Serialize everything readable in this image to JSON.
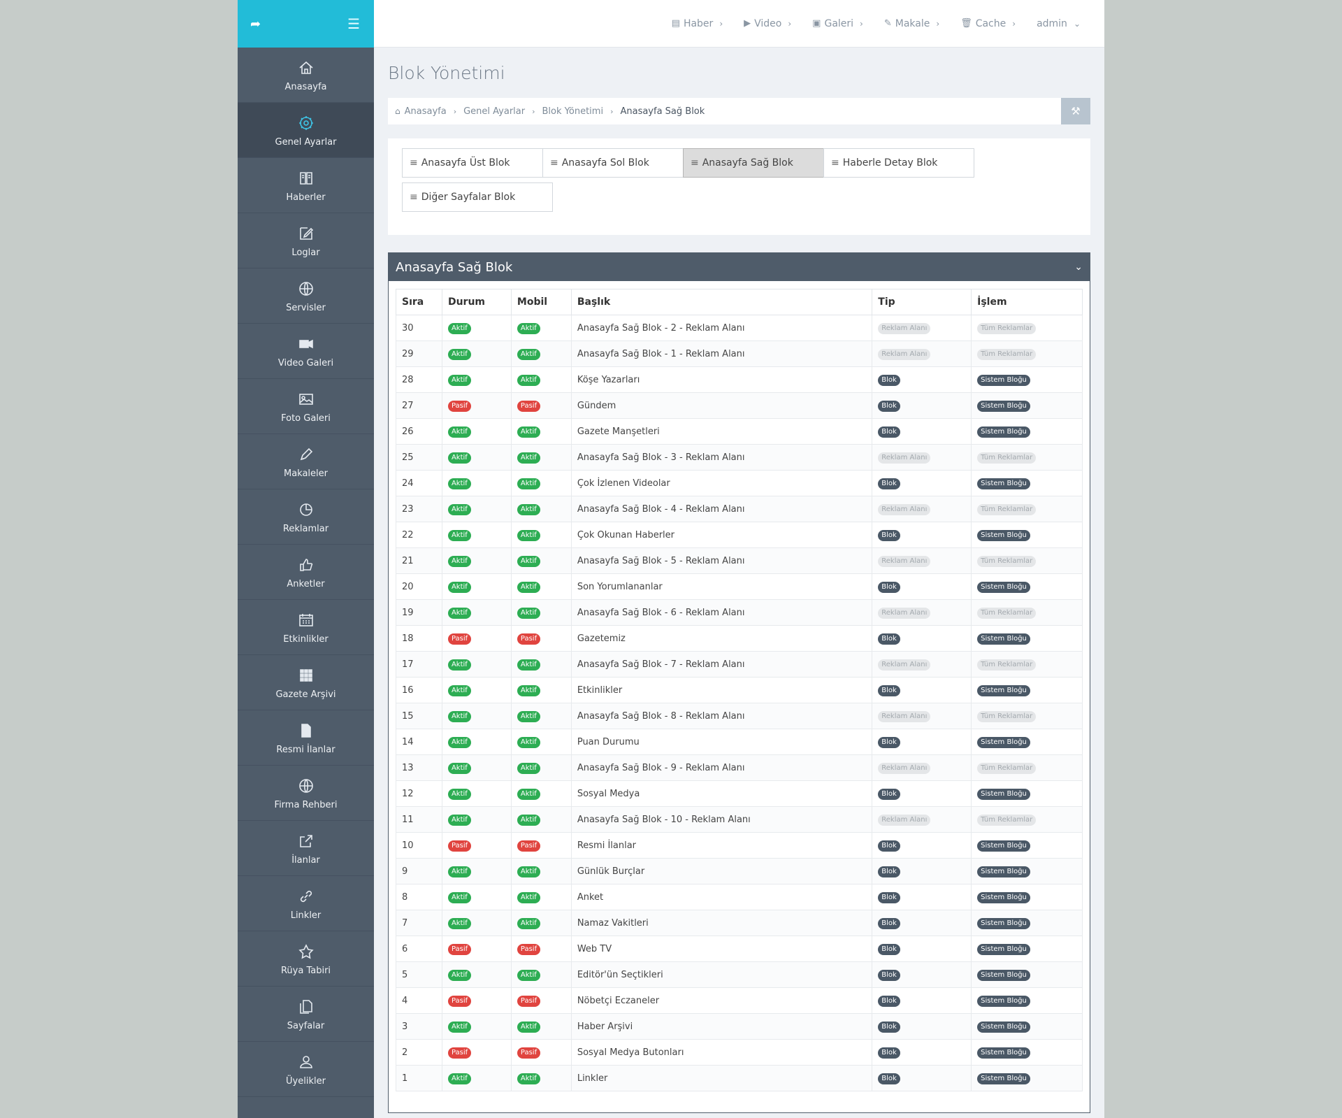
{
  "sidebar": {
    "items": [
      {
        "label": "Anasayfa",
        "icon": "home-icon",
        "active": false
      },
      {
        "label": "Genel Ayarlar",
        "icon": "gear-icon",
        "active": true
      },
      {
        "label": "Haberler",
        "icon": "book-icon",
        "active": false
      },
      {
        "label": "Loglar",
        "icon": "edit-icon",
        "active": false
      },
      {
        "label": "Servisler",
        "icon": "globe-icon",
        "active": false
      },
      {
        "label": "Video Galeri",
        "icon": "video-icon",
        "active": false
      },
      {
        "label": "Foto Galeri",
        "icon": "image-icon",
        "active": false
      },
      {
        "label": "Makaleler",
        "icon": "pencil-icon",
        "active": false
      },
      {
        "label": "Reklamlar",
        "icon": "pie-icon",
        "active": false
      },
      {
        "label": "Anketler",
        "icon": "thumbs-up-icon",
        "active": false
      },
      {
        "label": "Etkinlikler",
        "icon": "calendar-icon",
        "active": false
      },
      {
        "label": "Gazete Arşivi",
        "icon": "grid-icon",
        "active": false
      },
      {
        "label": "Resmi İlanlar",
        "icon": "file-icon",
        "active": false
      },
      {
        "label": "Firma Rehberi",
        "icon": "globe-icon",
        "active": false
      },
      {
        "label": "İlanlar",
        "icon": "share-icon",
        "active": false
      },
      {
        "label": "Linkler",
        "icon": "link-icon",
        "active": false
      },
      {
        "label": "Rüya Tabiri",
        "icon": "star-icon",
        "active": false
      },
      {
        "label": "Sayfalar",
        "icon": "copy-icon",
        "active": false
      },
      {
        "label": "Üyelikler",
        "icon": "user-icon",
        "active": false
      }
    ]
  },
  "topnav": {
    "items": [
      {
        "label": "Haber",
        "icon": "book-icon"
      },
      {
        "label": "Video",
        "icon": "video-icon"
      },
      {
        "label": "Galeri",
        "icon": "image-icon"
      },
      {
        "label": "Makale",
        "icon": "pencil-icon"
      },
      {
        "label": "Cache",
        "icon": "trash-icon"
      }
    ],
    "user": "admin"
  },
  "page": {
    "title": "Blok Yönetimi",
    "breadcrumb": [
      "Anasayfa",
      "Genel Ayarlar",
      "Blok Yönetimi",
      "Anasayfa Sağ Blok"
    ]
  },
  "blocks": [
    {
      "label": "Anasayfa Üst Blok",
      "active": false
    },
    {
      "label": "Anasayfa Sol Blok",
      "active": false
    },
    {
      "label": "Anasayfa Sağ Blok",
      "active": true
    },
    {
      "label": "Haberle Detay Blok",
      "active": false
    },
    {
      "label": "Diğer Sayfalar Blok",
      "active": false
    }
  ],
  "panel": {
    "title": "Anasayfa Sağ Blok",
    "headers": [
      "Sıra",
      "Durum",
      "Mobil",
      "Başlık",
      "Tip",
      "İşlem"
    ],
    "rows": [
      [
        "30",
        "Aktif",
        "Aktif",
        "Anasayfa Sağ Blok - 2 - Reklam Alanı",
        "Reklam Alanı",
        "Tüm Reklamlar"
      ],
      [
        "29",
        "Aktif",
        "Aktif",
        "Anasayfa Sağ Blok - 1 - Reklam Alanı",
        "Reklam Alanı",
        "Tüm Reklamlar"
      ],
      [
        "28",
        "Aktif",
        "Aktif",
        "Köşe Yazarları",
        "Blok",
        "Sistem Bloğu"
      ],
      [
        "27",
        "Pasif",
        "Pasif",
        "Gündem",
        "Blok",
        "Sistem Bloğu"
      ],
      [
        "26",
        "Aktif",
        "Aktif",
        "Gazete Manşetleri",
        "Blok",
        "Sistem Bloğu"
      ],
      [
        "25",
        "Aktif",
        "Aktif",
        "Anasayfa Sağ Blok - 3 - Reklam Alanı",
        "Reklam Alanı",
        "Tüm Reklamlar"
      ],
      [
        "24",
        "Aktif",
        "Aktif",
        "Çok İzlenen Videolar",
        "Blok",
        "Sistem Bloğu"
      ],
      [
        "23",
        "Aktif",
        "Aktif",
        "Anasayfa Sağ Blok - 4 - Reklam Alanı",
        "Reklam Alanı",
        "Tüm Reklamlar"
      ],
      [
        "22",
        "Aktif",
        "Aktif",
        "Çok Okunan Haberler",
        "Blok",
        "Sistem Bloğu"
      ],
      [
        "21",
        "Aktif",
        "Aktif",
        "Anasayfa Sağ Blok - 5 - Reklam Alanı",
        "Reklam Alanı",
        "Tüm Reklamlar"
      ],
      [
        "20",
        "Aktif",
        "Aktif",
        "Son Yorumlananlar",
        "Blok",
        "Sistem Bloğu"
      ],
      [
        "19",
        "Aktif",
        "Aktif",
        "Anasayfa Sağ Blok - 6 - Reklam Alanı",
        "Reklam Alanı",
        "Tüm Reklamlar"
      ],
      [
        "18",
        "Pasif",
        "Pasif",
        "Gazetemiz",
        "Blok",
        "Sistem Bloğu"
      ],
      [
        "17",
        "Aktif",
        "Aktif",
        "Anasayfa Sağ Blok - 7 - Reklam Alanı",
        "Reklam Alanı",
        "Tüm Reklamlar"
      ],
      [
        "16",
        "Aktif",
        "Aktif",
        "Etkinlikler",
        "Blok",
        "Sistem Bloğu"
      ],
      [
        "15",
        "Aktif",
        "Aktif",
        "Anasayfa Sağ Blok - 8 - Reklam Alanı",
        "Reklam Alanı",
        "Tüm Reklamlar"
      ],
      [
        "14",
        "Aktif",
        "Aktif",
        "Puan Durumu",
        "Blok",
        "Sistem Bloğu"
      ],
      [
        "13",
        "Aktif",
        "Aktif",
        "Anasayfa Sağ Blok - 9 - Reklam Alanı",
        "Reklam Alanı",
        "Tüm Reklamlar"
      ],
      [
        "12",
        "Aktif",
        "Aktif",
        "Sosyal Medya",
        "Blok",
        "Sistem Bloğu"
      ],
      [
        "11",
        "Aktif",
        "Aktif",
        "Anasayfa Sağ Blok - 10 - Reklam Alanı",
        "Reklam Alanı",
        "Tüm Reklamlar"
      ],
      [
        "10",
        "Pasif",
        "Pasif",
        "Resmi İlanlar",
        "Blok",
        "Sistem Bloğu"
      ],
      [
        "9",
        "Aktif",
        "Aktif",
        "Günlük Burçlar",
        "Blok",
        "Sistem Bloğu"
      ],
      [
        "8",
        "Aktif",
        "Aktif",
        "Anket",
        "Blok",
        "Sistem Bloğu"
      ],
      [
        "7",
        "Aktif",
        "Aktif",
        "Namaz Vakitleri",
        "Blok",
        "Sistem Bloğu"
      ],
      [
        "6",
        "Pasif",
        "Pasif",
        "Web TV",
        "Blok",
        "Sistem Bloğu"
      ],
      [
        "5",
        "Aktif",
        "Aktif",
        "Editör'ün Seçtikleri",
        "Blok",
        "Sistem Bloğu"
      ],
      [
        "4",
        "Pasif",
        "Pasif",
        "Nöbetçi Eczaneler",
        "Blok",
        "Sistem Bloğu"
      ],
      [
        "3",
        "Aktif",
        "Aktif",
        "Haber Arşivi",
        "Blok",
        "Sistem Bloğu"
      ],
      [
        "2",
        "Pasif",
        "Pasif",
        "Sosyal Medya Butonları",
        "Blok",
        "Sistem Bloğu"
      ],
      [
        "1",
        "Aktif",
        "Aktif",
        "Linkler",
        "Blok",
        "Sistem Bloğu"
      ]
    ]
  },
  "colors": {
    "accent": "#22bcd8",
    "sidebar": "#4f5c6a",
    "active": "#2dad53",
    "passive": "#e0443f"
  }
}
